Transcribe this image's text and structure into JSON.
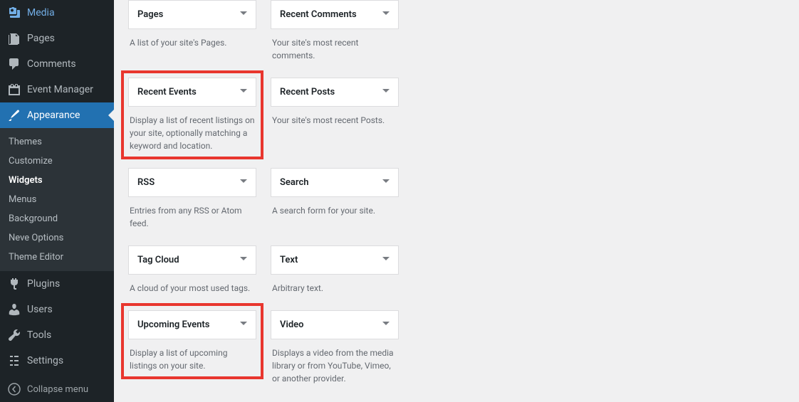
{
  "sidebar": {
    "media": "Media",
    "pages": "Pages",
    "comments": "Comments",
    "event_manager": "Event Manager",
    "appearance": "Appearance",
    "themes": "Themes",
    "customize": "Customize",
    "widgets": "Widgets",
    "menus": "Menus",
    "background": "Background",
    "neve_options": "Neve Options",
    "theme_editor": "Theme Editor",
    "plugins": "Plugins",
    "users": "Users",
    "tools": "Tools",
    "settings": "Settings",
    "collapse": "Collapse menu"
  },
  "widgets": {
    "pages": {
      "title": "Pages",
      "desc": "A list of your site's Pages."
    },
    "recent_comments": {
      "title": "Recent Comments",
      "desc": "Your site's most recent comments."
    },
    "recent_events": {
      "title": "Recent Events",
      "desc": "Display a list of recent listings on your site, optionally matching a keyword and location."
    },
    "recent_posts": {
      "title": "Recent Posts",
      "desc": "Your site's most recent Posts."
    },
    "rss": {
      "title": "RSS",
      "desc": "Entries from any RSS or Atom feed."
    },
    "search": {
      "title": "Search",
      "desc": "A search form for your site."
    },
    "tag_cloud": {
      "title": "Tag Cloud",
      "desc": "A cloud of your most used tags."
    },
    "text": {
      "title": "Text",
      "desc": "Arbitrary text."
    },
    "upcoming_events": {
      "title": "Upcoming Events",
      "desc": "Display a list of upcoming listings on your site."
    },
    "video": {
      "title": "Video",
      "desc": "Displays a video from the media library or from YouTube, Vimeo, or another provider."
    }
  }
}
